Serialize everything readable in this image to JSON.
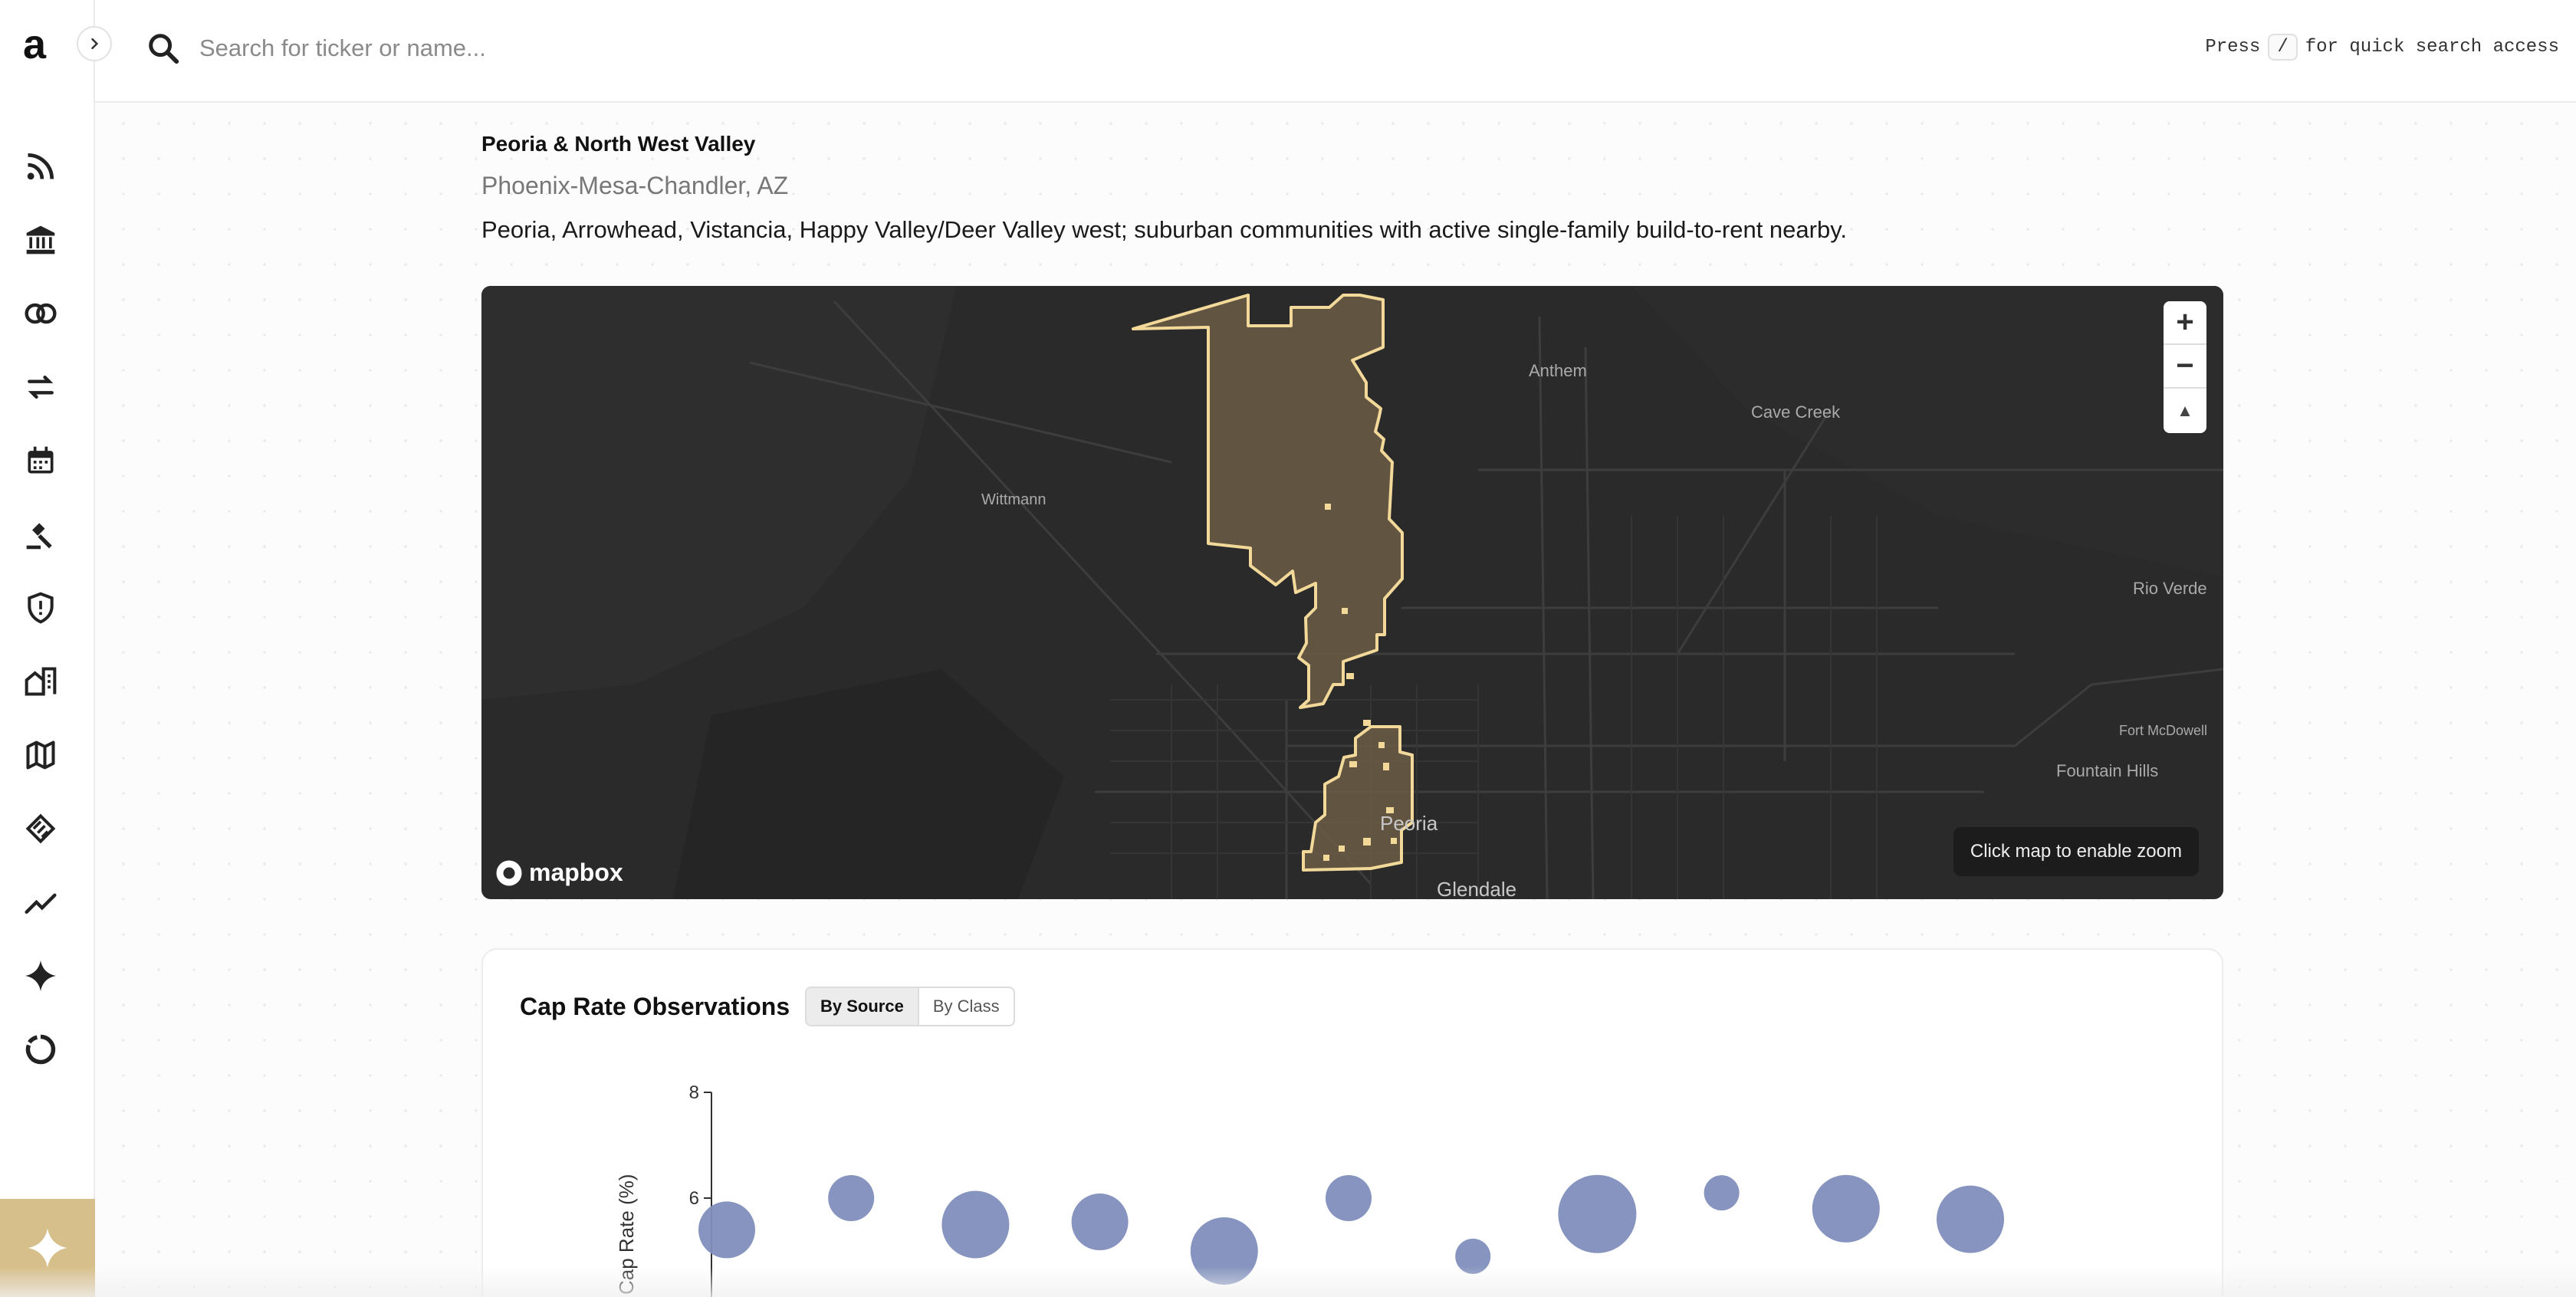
{
  "app": {
    "logo": "a"
  },
  "sidebar": {
    "items": [
      {
        "name": "feed-icon"
      },
      {
        "name": "bank-icon"
      },
      {
        "name": "rings-icon"
      },
      {
        "name": "transfer-icon"
      },
      {
        "name": "calendar-icon"
      },
      {
        "name": "gavel-icon"
      },
      {
        "name": "shield-icon"
      },
      {
        "name": "buildings-icon"
      },
      {
        "name": "map-icon"
      },
      {
        "name": "handshake-icon"
      },
      {
        "name": "trend-icon"
      },
      {
        "name": "sparkle-icon"
      },
      {
        "name": "donut-icon"
      }
    ]
  },
  "search": {
    "placeholder": "Search for ticker or name...",
    "hint_prefix": "Press",
    "hint_key": "/",
    "hint_suffix": "for quick search access"
  },
  "region": {
    "title": "Peoria & North West Valley",
    "metro": "Phoenix-Mesa-Chandler, AZ",
    "description": "Peoria, Arrowhead, Vistancia, Happy Valley/Deer Valley west; suburban communities with active single-family build-to-rent nearby."
  },
  "map": {
    "labels": {
      "anthem": "Anthem",
      "cave_creek": "Cave Creek",
      "wittmann": "Wittmann",
      "rio_verde": "Rio Verde",
      "fort_mcdowell": "Fort McDowell",
      "fountain_hills": "Fountain Hills",
      "peoria": "Peoria",
      "glendale": "Glendale"
    },
    "attribution": "mapbox",
    "tooltip": "Click map to enable zoom",
    "zoom_in": "+",
    "zoom_out": "−",
    "compass": "▲",
    "colors": {
      "background": "#2a2a2a",
      "highlight_fill": "#6b5c44",
      "highlight_stroke": "#f2d99a"
    }
  },
  "cap_rate": {
    "title": "Cap Rate Observations",
    "tabs": [
      {
        "label": "By Source",
        "active": true
      },
      {
        "label": "By Class",
        "active": false
      }
    ],
    "bubble_color": "#7f8ebc"
  },
  "chart_data": {
    "type": "scatter",
    "title": "Cap Rate Observations",
    "ylabel": "Cap Rate (%)",
    "ylim": [
      4,
      8
    ],
    "yticks": [
      8,
      6
    ],
    "points": [
      {
        "x": 0,
        "y": 5.4,
        "size": 3
      },
      {
        "x": 1,
        "y": 6.0,
        "size": 2
      },
      {
        "x": 2,
        "y": 5.5,
        "size": 4
      },
      {
        "x": 3,
        "y": 5.55,
        "size": 3
      },
      {
        "x": 4,
        "y": 5.0,
        "size": 4
      },
      {
        "x": 5,
        "y": 6.0,
        "size": 2
      },
      {
        "x": 6,
        "y": 4.9,
        "size": 1
      },
      {
        "x": 7,
        "y": 5.7,
        "size": 5
      },
      {
        "x": 8,
        "y": 6.1,
        "size": 1
      },
      {
        "x": 9,
        "y": 5.8,
        "size": 4
      },
      {
        "x": 10,
        "y": 5.6,
        "size": 4
      }
    ]
  }
}
